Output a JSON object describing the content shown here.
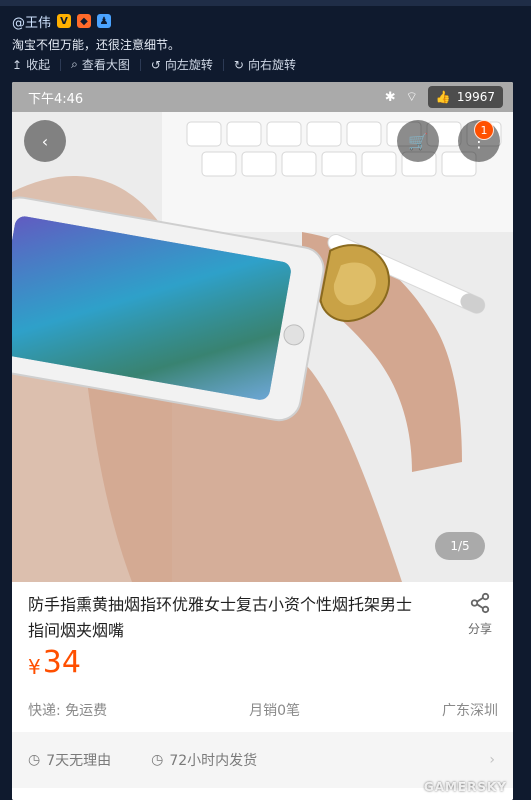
{
  "post": {
    "author": "@王伟",
    "text": "淘宝不但万能，还很注意细节。",
    "actions": [
      {
        "label": "收起",
        "icon": "arrow-up-icon"
      },
      {
        "label": "查看大图",
        "icon": "search-icon"
      },
      {
        "label": "向左旋转",
        "icon": "rotate-left-icon"
      },
      {
        "label": "向右旋转",
        "icon": "rotate-right-icon"
      }
    ]
  },
  "phone": {
    "time": "下午4:46",
    "likes": "19967"
  },
  "product": {
    "title": "防手指熏黄抽烟指环优雅女士复古小资个性烟托架男士指间烟夹烟嘴",
    "share_label": "分享",
    "price_symbol": "¥",
    "price_value": "34",
    "image_index": "1/5",
    "cart_badge": "1",
    "shipping": "快递: 免运费",
    "monthly_sales": "月销0笔",
    "location": "广东深圳",
    "guarantees": [
      "7天无理由",
      "72小时内发货"
    ]
  },
  "watermark": "GAMERSKY",
  "colors": {
    "background": "#0f1a2e",
    "price": "#ff4f00",
    "badge": "#ff5000"
  }
}
